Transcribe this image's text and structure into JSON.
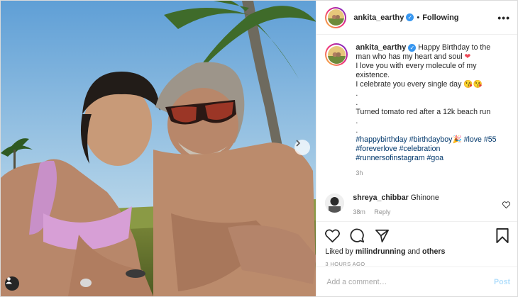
{
  "colors": {
    "accent": "#3897f0",
    "heart_red": "#ed4956",
    "link": "#00376b",
    "muted": "#8e8e8e"
  },
  "header": {
    "username": "ankita_earthy",
    "separator": "•",
    "following_label": "Following",
    "more_label": "•••"
  },
  "caption": {
    "username": "ankita_earthy",
    "line1": "Happy Birthday to the man who has my heart and soul",
    "line2": "I love you with every molecule of my existence.",
    "line3": "I celebrate you every single day",
    "dot1": ".",
    "dot2": ".",
    "line4": "Turned tomato red after a 12k beach run",
    "dot3": ".",
    "dot4": ".",
    "hashtags": "#happybirthday #birthdayboy🎉 #love #55 #foreverlove #celebration #runnersofinstagram #goa",
    "time": "3h"
  },
  "comment": {
    "username": "shreya_chibbar",
    "text": "Ghinone",
    "time": "38m",
    "reply_label": "Reply"
  },
  "engagement": {
    "liked_by_prefix": "Liked by",
    "liked_by_user": "milindrunning",
    "and": "and",
    "others": "others",
    "date": "3 HOURS AGO"
  },
  "add_comment": {
    "placeholder": "Add a comment…",
    "post_label": "Post"
  },
  "icons": [
    "chevron-right-icon",
    "user-tag-icon",
    "verified-icon",
    "heart-icon",
    "comment-icon",
    "share-icon",
    "bookmark-icon",
    "more-icon"
  ]
}
